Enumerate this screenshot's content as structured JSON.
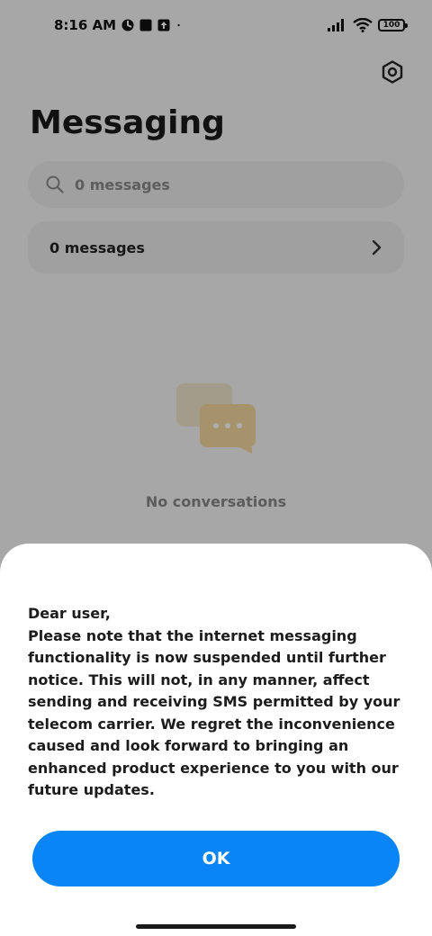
{
  "status_bar": {
    "time": "8:16 AM",
    "battery": "100"
  },
  "header": {
    "title": "Messaging",
    "settings_icon": "gear-icon"
  },
  "search": {
    "placeholder": "0 messages",
    "icon": "search-icon"
  },
  "messages_row": {
    "label": "0 messages",
    "icon": "chevron-right-icon"
  },
  "empty_state": {
    "text": "No conversations",
    "icon": "chat-bubbles-icon"
  },
  "dialog": {
    "greeting": "Dear user,",
    "body": "Please note that the internet messaging functionality is now suspended until further notice. This will not, in any manner, affect sending and receiving SMS permitted by your telecom carrier. We regret the inconvenience caused and look forward to bringing an enhanced product experience to you with our future updates.",
    "ok_label": "OK"
  },
  "colors": {
    "accent": "#0a85f5",
    "illustration": "#f5d9a0"
  }
}
